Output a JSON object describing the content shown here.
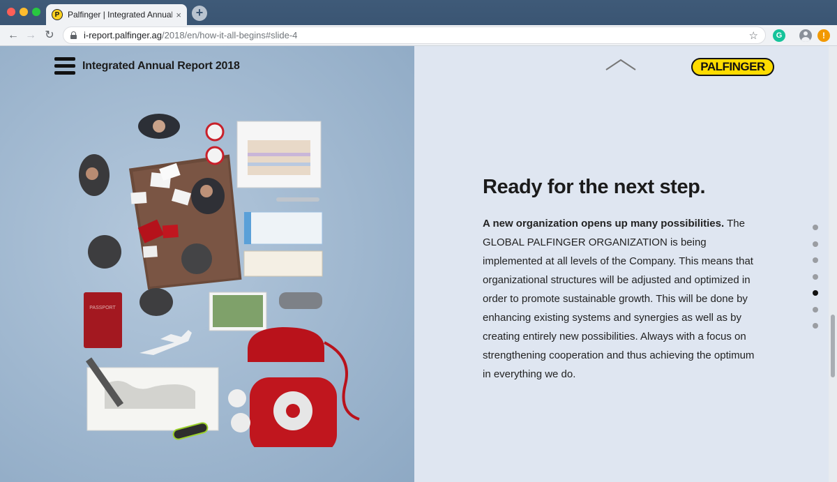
{
  "browser": {
    "tab_title": "Palfinger | Integrated Annual R",
    "tab_favicon_letter": "P",
    "tab_close": "×",
    "new_tab": "+",
    "url_host": "i-report.palfinger.ag",
    "url_path": "/2018/en/how-it-all-begins#slide-4",
    "extension_letter": "G",
    "update_badge": "!"
  },
  "header": {
    "report_title": "Integrated Annual Report 2018",
    "logo_text": "PALFINGER"
  },
  "illustration": {
    "passport_label": "PASSPORT"
  },
  "content": {
    "headline": "Ready for the next step.",
    "lead": "A new organization opens up many possibilities.",
    "body": " The GLOBAL PALFINGER ORGANIZATION is being implemented at all levels of the Company. This means that organizational structures will be adjusted and optimized in order to promote sustainable growth. This will be done by enhancing existing systems and synergies as well as by creating entirely new possibilities. Always with a focus on strengthening cooperation and thus achieving the optimum in everything we do."
  },
  "slides": {
    "count": 7,
    "active_index": 4
  },
  "colors": {
    "brand_yellow": "#ffdc00",
    "left_panel": "#9fb7cf",
    "right_panel": "#dfe6f1",
    "phone_red": "#c0161e"
  }
}
